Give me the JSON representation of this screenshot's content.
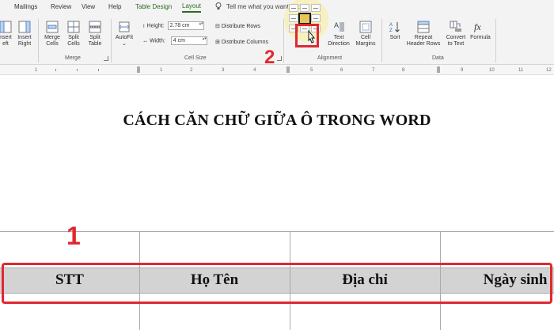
{
  "tabs": [
    "Mailings",
    "Review",
    "View",
    "Help",
    "Table Design",
    "Layout"
  ],
  "tell_me": "Tell me what you want to do",
  "rows_columns": {
    "insert_left": "Insert Left",
    "insert_left_line1": "nsert",
    "insert_left_line2": "eft",
    "insert_right_line1": "Insert",
    "insert_right_line2": "Right"
  },
  "merge": {
    "merge_cells_line1": "Merge",
    "merge_cells_line2": "Cells",
    "split_cells_line1": "Split",
    "split_cells_line2": "Cells",
    "split_table_line1": "Split",
    "split_table_line2": "Table",
    "group_label": "Merge"
  },
  "cell_size": {
    "autofit": "AutoFit",
    "height_label": "Height:",
    "height_value": "2.78 cm",
    "width_label": "Width:",
    "width_value": "4 cm",
    "distribute_rows": "Distribute Rows",
    "distribute_columns": "Distribute Columns",
    "group_label": "Cell Size"
  },
  "alignment": {
    "text_direction_line1": "Text",
    "text_direction_line2": "Direction",
    "cell_margins_line1": "Cell",
    "cell_margins_line2": "Margins",
    "group_label": "Alignment"
  },
  "data_group": {
    "sort": "Sort",
    "repeat_header_line1": "Repeat",
    "repeat_header_line2": "Header Rows",
    "convert_line1": "Convert",
    "convert_line2": "to Text",
    "formula": "Formula",
    "group_label": "Data"
  },
  "ruler_marks": [
    "1",
    "1",
    "2",
    "3",
    "4",
    "5",
    "6",
    "7",
    "8",
    "9",
    "10",
    "11",
    "12"
  ],
  "annotations": {
    "step1": "1",
    "step2": "2"
  },
  "document": {
    "title": "CÁCH CĂN CHỮ GIỮA Ô TRONG WORD",
    "header_cells": [
      "STT",
      "Họ Tên",
      "Địa chỉ",
      "Ngày sinh"
    ]
  },
  "colors": {
    "highlight": "#e0282e",
    "accent": "#2e6b23",
    "header_fill": "#d3d3d3"
  }
}
